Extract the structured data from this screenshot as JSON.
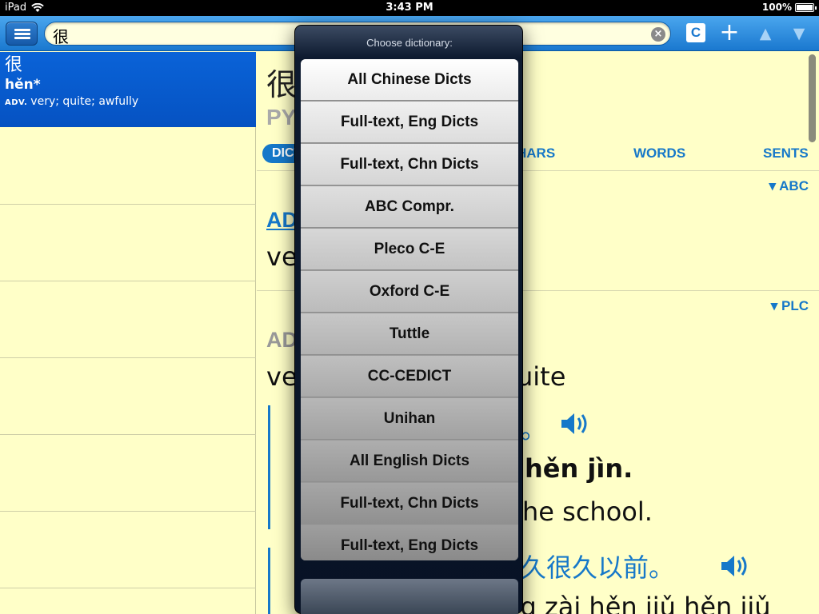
{
  "status_bar": {
    "device": "iPad",
    "time": "3:43 PM",
    "battery": "100%"
  },
  "toolbar": {
    "search_value": "很",
    "clear_icon": "clear-icon",
    "c_label": "C",
    "plus_label": "+",
    "up_label": "▲",
    "down_label": "▼"
  },
  "results": {
    "items": [
      {
        "character": "很",
        "pinyin": "hěn*",
        "pos": "ADV.",
        "definition": "very; quite; awfully"
      }
    ]
  },
  "entry": {
    "headword": "很",
    "pinyin_label": "PY",
    "tabs": [
      {
        "label": "DICT"
      },
      {
        "label": "HARS"
      },
      {
        "label": "WORDS"
      },
      {
        "label": "SENTS"
      }
    ],
    "sections": [
      {
        "tag": "ABC",
        "pos": "AD",
        "definition": "ve"
      },
      {
        "tag": "PLC",
        "pos": "AD",
        "definition": "ve"
      }
    ],
    "fragments": {
      "plc_def_tail": "uite",
      "ex1_chn_tail": "。",
      "ex1_pinyin_tail": "hěn jìn.",
      "ex1_eng_tail": "he school.",
      "ex2_chn_tail": "久很久以前。",
      "ex2_pinyin_line": "Zhè gùshi fāshēng zài hěn jiǔ hěn jiǔ"
    }
  },
  "popover": {
    "title": "Choose dictionary:",
    "options": [
      "All Chinese Dicts",
      "Full-text, Eng Dicts",
      "Full-text, Chn Dicts",
      "ABC Compr.",
      "Pleco C-E",
      "Oxford C-E",
      "Tuttle",
      "CC-CEDICT",
      "Unihan",
      "All English Dicts",
      "Full-text, Chn Dicts",
      "Full-text, Eng Dicts"
    ],
    "selected_index": 0
  }
}
